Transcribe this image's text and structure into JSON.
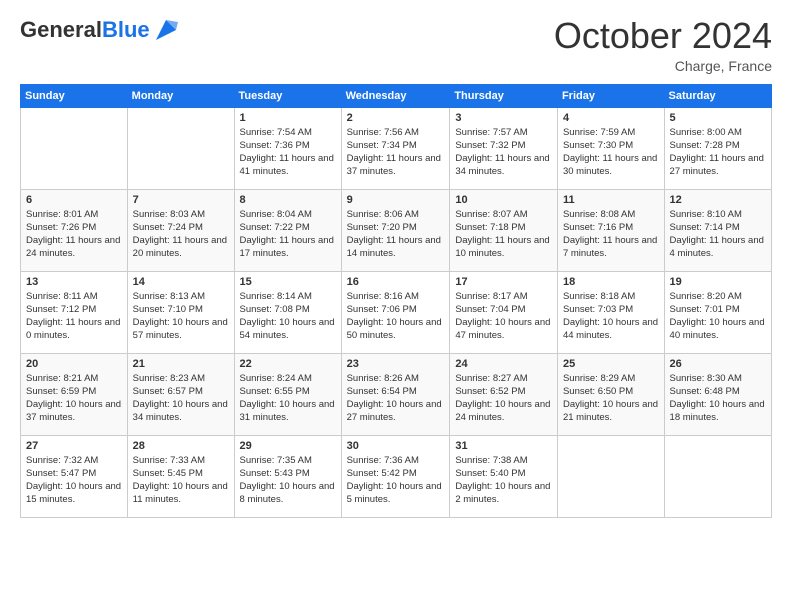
{
  "header": {
    "logo": {
      "general": "General",
      "blue": "Blue"
    },
    "title": "October 2024",
    "location": "Charge, France"
  },
  "days_of_week": [
    "Sunday",
    "Monday",
    "Tuesday",
    "Wednesday",
    "Thursday",
    "Friday",
    "Saturday"
  ],
  "weeks": [
    [
      {
        "day": "",
        "sunrise": "",
        "sunset": "",
        "daylight": ""
      },
      {
        "day": "",
        "sunrise": "",
        "sunset": "",
        "daylight": ""
      },
      {
        "day": "1",
        "sunrise": "Sunrise: 7:54 AM",
        "sunset": "Sunset: 7:36 PM",
        "daylight": "Daylight: 11 hours and 41 minutes."
      },
      {
        "day": "2",
        "sunrise": "Sunrise: 7:56 AM",
        "sunset": "Sunset: 7:34 PM",
        "daylight": "Daylight: 11 hours and 37 minutes."
      },
      {
        "day": "3",
        "sunrise": "Sunrise: 7:57 AM",
        "sunset": "Sunset: 7:32 PM",
        "daylight": "Daylight: 11 hours and 34 minutes."
      },
      {
        "day": "4",
        "sunrise": "Sunrise: 7:59 AM",
        "sunset": "Sunset: 7:30 PM",
        "daylight": "Daylight: 11 hours and 30 minutes."
      },
      {
        "day": "5",
        "sunrise": "Sunrise: 8:00 AM",
        "sunset": "Sunset: 7:28 PM",
        "daylight": "Daylight: 11 hours and 27 minutes."
      }
    ],
    [
      {
        "day": "6",
        "sunrise": "Sunrise: 8:01 AM",
        "sunset": "Sunset: 7:26 PM",
        "daylight": "Daylight: 11 hours and 24 minutes."
      },
      {
        "day": "7",
        "sunrise": "Sunrise: 8:03 AM",
        "sunset": "Sunset: 7:24 PM",
        "daylight": "Daylight: 11 hours and 20 minutes."
      },
      {
        "day": "8",
        "sunrise": "Sunrise: 8:04 AM",
        "sunset": "Sunset: 7:22 PM",
        "daylight": "Daylight: 11 hours and 17 minutes."
      },
      {
        "day": "9",
        "sunrise": "Sunrise: 8:06 AM",
        "sunset": "Sunset: 7:20 PM",
        "daylight": "Daylight: 11 hours and 14 minutes."
      },
      {
        "day": "10",
        "sunrise": "Sunrise: 8:07 AM",
        "sunset": "Sunset: 7:18 PM",
        "daylight": "Daylight: 11 hours and 10 minutes."
      },
      {
        "day": "11",
        "sunrise": "Sunrise: 8:08 AM",
        "sunset": "Sunset: 7:16 PM",
        "daylight": "Daylight: 11 hours and 7 minutes."
      },
      {
        "day": "12",
        "sunrise": "Sunrise: 8:10 AM",
        "sunset": "Sunset: 7:14 PM",
        "daylight": "Daylight: 11 hours and 4 minutes."
      }
    ],
    [
      {
        "day": "13",
        "sunrise": "Sunrise: 8:11 AM",
        "sunset": "Sunset: 7:12 PM",
        "daylight": "Daylight: 11 hours and 0 minutes."
      },
      {
        "day": "14",
        "sunrise": "Sunrise: 8:13 AM",
        "sunset": "Sunset: 7:10 PM",
        "daylight": "Daylight: 10 hours and 57 minutes."
      },
      {
        "day": "15",
        "sunrise": "Sunrise: 8:14 AM",
        "sunset": "Sunset: 7:08 PM",
        "daylight": "Daylight: 10 hours and 54 minutes."
      },
      {
        "day": "16",
        "sunrise": "Sunrise: 8:16 AM",
        "sunset": "Sunset: 7:06 PM",
        "daylight": "Daylight: 10 hours and 50 minutes."
      },
      {
        "day": "17",
        "sunrise": "Sunrise: 8:17 AM",
        "sunset": "Sunset: 7:04 PM",
        "daylight": "Daylight: 10 hours and 47 minutes."
      },
      {
        "day": "18",
        "sunrise": "Sunrise: 8:18 AM",
        "sunset": "Sunset: 7:03 PM",
        "daylight": "Daylight: 10 hours and 44 minutes."
      },
      {
        "day": "19",
        "sunrise": "Sunrise: 8:20 AM",
        "sunset": "Sunset: 7:01 PM",
        "daylight": "Daylight: 10 hours and 40 minutes."
      }
    ],
    [
      {
        "day": "20",
        "sunrise": "Sunrise: 8:21 AM",
        "sunset": "Sunset: 6:59 PM",
        "daylight": "Daylight: 10 hours and 37 minutes."
      },
      {
        "day": "21",
        "sunrise": "Sunrise: 8:23 AM",
        "sunset": "Sunset: 6:57 PM",
        "daylight": "Daylight: 10 hours and 34 minutes."
      },
      {
        "day": "22",
        "sunrise": "Sunrise: 8:24 AM",
        "sunset": "Sunset: 6:55 PM",
        "daylight": "Daylight: 10 hours and 31 minutes."
      },
      {
        "day": "23",
        "sunrise": "Sunrise: 8:26 AM",
        "sunset": "Sunset: 6:54 PM",
        "daylight": "Daylight: 10 hours and 27 minutes."
      },
      {
        "day": "24",
        "sunrise": "Sunrise: 8:27 AM",
        "sunset": "Sunset: 6:52 PM",
        "daylight": "Daylight: 10 hours and 24 minutes."
      },
      {
        "day": "25",
        "sunrise": "Sunrise: 8:29 AM",
        "sunset": "Sunset: 6:50 PM",
        "daylight": "Daylight: 10 hours and 21 minutes."
      },
      {
        "day": "26",
        "sunrise": "Sunrise: 8:30 AM",
        "sunset": "Sunset: 6:48 PM",
        "daylight": "Daylight: 10 hours and 18 minutes."
      }
    ],
    [
      {
        "day": "27",
        "sunrise": "Sunrise: 7:32 AM",
        "sunset": "Sunset: 5:47 PM",
        "daylight": "Daylight: 10 hours and 15 minutes."
      },
      {
        "day": "28",
        "sunrise": "Sunrise: 7:33 AM",
        "sunset": "Sunset: 5:45 PM",
        "daylight": "Daylight: 10 hours and 11 minutes."
      },
      {
        "day": "29",
        "sunrise": "Sunrise: 7:35 AM",
        "sunset": "Sunset: 5:43 PM",
        "daylight": "Daylight: 10 hours and 8 minutes."
      },
      {
        "day": "30",
        "sunrise": "Sunrise: 7:36 AM",
        "sunset": "Sunset: 5:42 PM",
        "daylight": "Daylight: 10 hours and 5 minutes."
      },
      {
        "day": "31",
        "sunrise": "Sunrise: 7:38 AM",
        "sunset": "Sunset: 5:40 PM",
        "daylight": "Daylight: 10 hours and 2 minutes."
      },
      {
        "day": "",
        "sunrise": "",
        "sunset": "",
        "daylight": ""
      },
      {
        "day": "",
        "sunrise": "",
        "sunset": "",
        "daylight": ""
      }
    ]
  ]
}
